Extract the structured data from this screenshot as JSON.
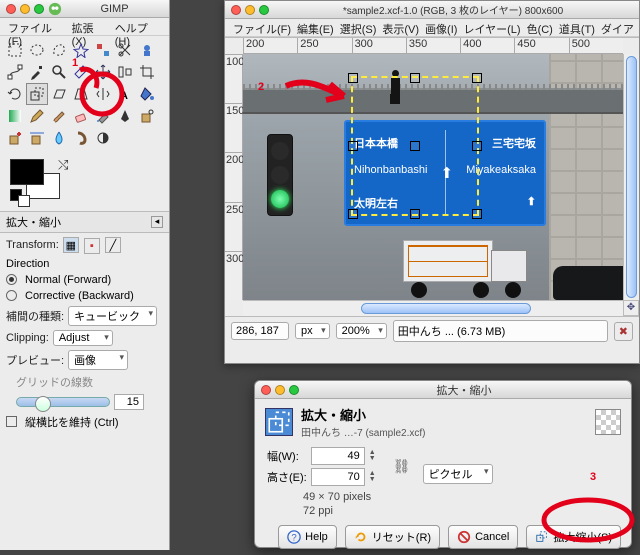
{
  "toolbox": {
    "title": "GIMP",
    "menu": {
      "file": "ファイル(F)",
      "xtns": "拡張(X)",
      "help": "ヘルプ(H)"
    },
    "options_title": "拡大・縮小",
    "transform_label": "Transform:",
    "direction_label": "Direction",
    "direction_normal": "Normal (Forward)",
    "direction_corrective": "Corrective (Backward)",
    "interp_label": "補間の種類:",
    "interp_value": "キュービック",
    "clipping_label": "Clipping:",
    "clipping_value": "Adjust",
    "preview_label": "プレビュー:",
    "preview_value": "画像",
    "grid_lines": "グリッドの線数",
    "grid_value": "15",
    "keep_aspect": "縦横比を維持 (Ctrl)"
  },
  "imagewin": {
    "title": "*sample2.xcf-1.0 (RGB, 3 枚のレイヤー) 800x600",
    "menu": {
      "file": "ファイル(F)",
      "edit": "編集(E)",
      "select": "選択(S)",
      "view": "表示(V)",
      "image": "画像(I)",
      "layer": "レイヤー(L)",
      "colors": "色(C)",
      "tools": "道具(T)",
      "dialogs": "ダイア"
    },
    "ruler_h": [
      "200",
      "250",
      "300",
      "350",
      "400",
      "450",
      "500"
    ],
    "ruler_v": [
      "100",
      "150",
      "200",
      "250",
      "300"
    ],
    "sign": {
      "left_jp": "日本本橋",
      "right_jp": "三宅宅坂",
      "left_en": "Nihonbanbashi",
      "right_en": "Miyakeaksaka",
      "bottom": "太明左右"
    },
    "coords": "286, 187",
    "unit": "px",
    "zoom": "200%",
    "filestat": "田中んち ... (6.73 MB)"
  },
  "dialog": {
    "title": "拡大・縮小",
    "header": "拡大・縮小",
    "subtitle": "田中んち …-7 (sample2.xcf)",
    "width_label": "幅(W):",
    "width_value": "49",
    "height_label": "高さ(E):",
    "height_value": "70",
    "unit": "ピクセル",
    "meta1": "49 × 70 pixels",
    "meta2": "72 ppi",
    "help": "Help",
    "reset": "リセット(R)",
    "cancel": "Cancel",
    "scale": "拡大縮小(S)"
  },
  "annotations": {
    "n1": "1",
    "n2": "2",
    "n3": "3"
  }
}
